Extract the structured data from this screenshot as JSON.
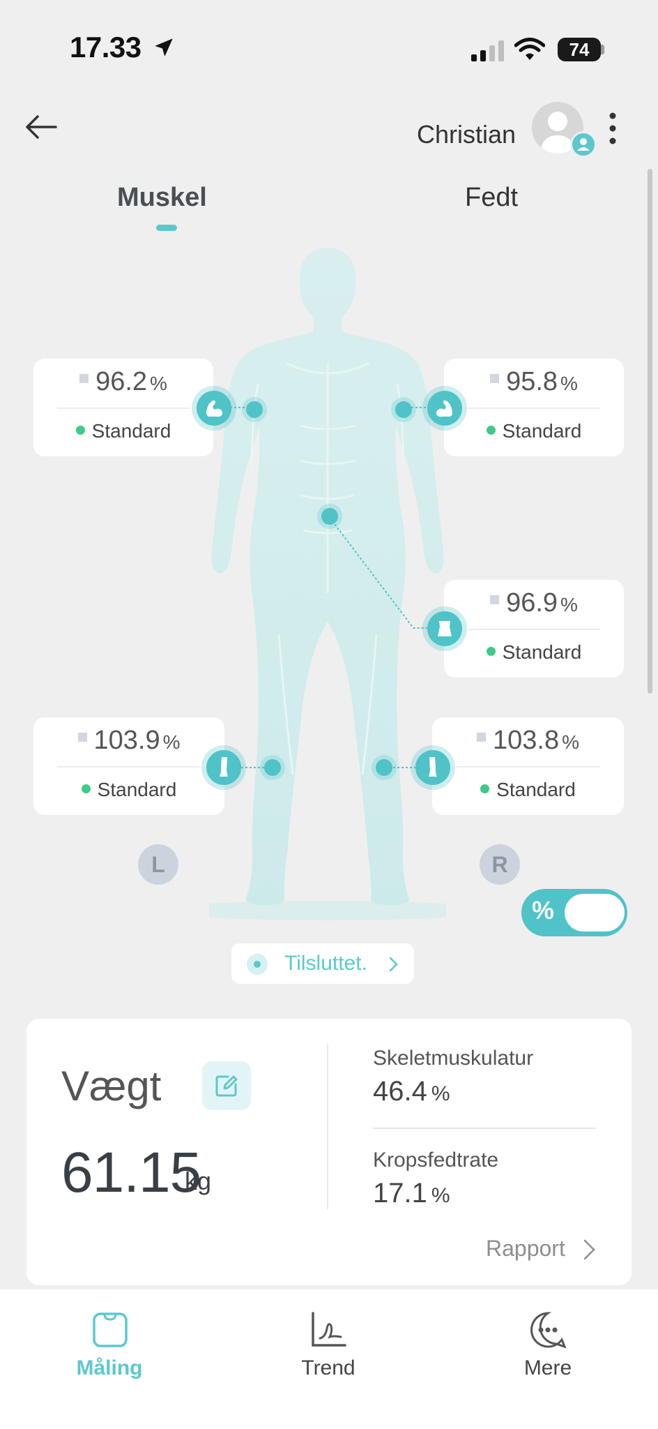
{
  "status_bar": {
    "time": "17.33",
    "battery": "74"
  },
  "header": {
    "user_name": "Christian"
  },
  "tabs": [
    {
      "label": "Muskel",
      "active": true
    },
    {
      "label": "Fedt",
      "active": false
    }
  ],
  "segments": {
    "left_arm": {
      "value": "96.2",
      "unit": "%",
      "status": "Standard"
    },
    "right_arm": {
      "value": "95.8",
      "unit": "%",
      "status": "Standard"
    },
    "trunk": {
      "value": "96.9",
      "unit": "%",
      "status": "Standard"
    },
    "left_leg": {
      "value": "103.9",
      "unit": "%",
      "status": "Standard"
    },
    "right_leg": {
      "value": "103.8",
      "unit": "%",
      "status": "Standard"
    }
  },
  "side_labels": {
    "left": "L",
    "right": "R"
  },
  "toggle": {
    "label": "%",
    "on": true
  },
  "connection": {
    "label": "Tilsluttet."
  },
  "weight_panel": {
    "title": "Vægt",
    "weight_value": "61.15",
    "weight_unit": "kg",
    "metrics": [
      {
        "label": "Skeletmuskulatur",
        "value": "46.4",
        "unit": "%"
      },
      {
        "label": "Kropsfedtrate",
        "value": "17.1",
        "unit": "%"
      }
    ],
    "report_label": "Rapport"
  },
  "bottom_nav": [
    {
      "label": "Måling",
      "active": true
    },
    {
      "label": "Trend",
      "active": false
    },
    {
      "label": "Mere",
      "active": false
    }
  ],
  "colors": {
    "accent": "#5cc8cc",
    "status_ok": "#3ecb87",
    "background": "#efefef"
  }
}
